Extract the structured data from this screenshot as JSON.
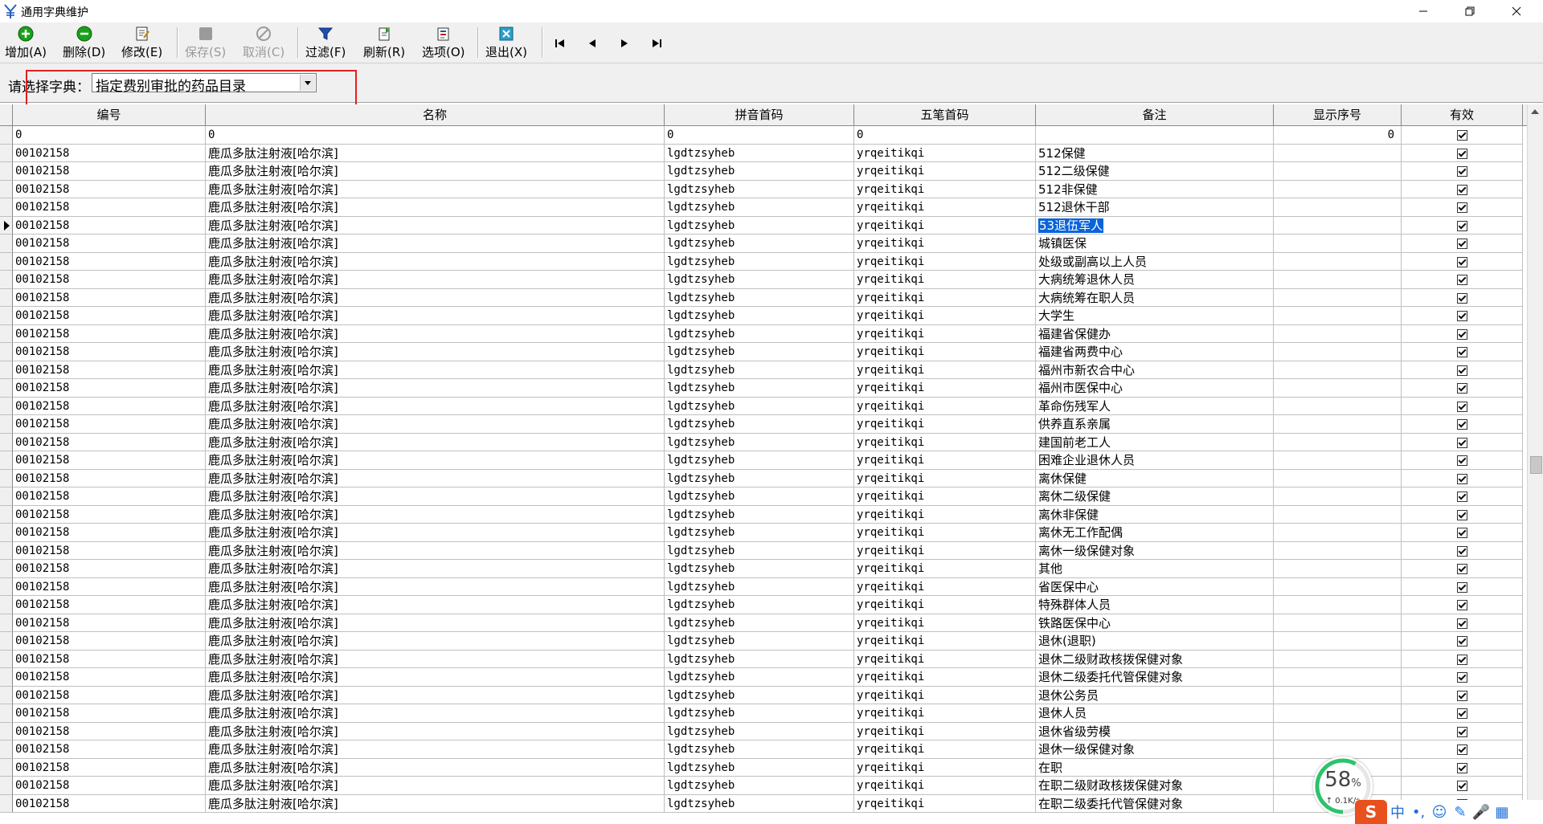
{
  "window": {
    "title": "通用字典维护",
    "minimize": "—",
    "maximize": "❐",
    "close": "✕"
  },
  "toolbar": {
    "add": "增加(A)",
    "delete": "删除(D)",
    "edit": "修改(E)",
    "save": "保存(S)",
    "cancel": "取消(C)",
    "filter": "过滤(F)",
    "refresh": "刷新(R)",
    "options": "选项(O)",
    "exit": "退出(X)",
    "first": "⏮",
    "prev": "◀",
    "next": "▶",
    "last": "⏭"
  },
  "selector": {
    "label": "请选择字典：",
    "value": "指定费别审批的药品目录"
  },
  "grid": {
    "columns": [
      "编号",
      "名称",
      "拼音首码",
      "五笔首码",
      "备注",
      "显示序号",
      "有效"
    ],
    "first_row": {
      "code": "0",
      "name": "0",
      "pinyin": "0",
      "wubi": "0",
      "note": "",
      "order": "0"
    },
    "row_code": "00102158",
    "row_name": "鹿瓜多肽注射液[哈尔滨]",
    "row_pinyin": "lgdtzsyheb",
    "row_wubi": "yrqeitikqi",
    "notes": [
      "512保健",
      "512二级保健",
      "512非保健",
      "512退休干部",
      "53退伍军人",
      "城镇医保",
      "处级或副高以上人员",
      "大病统筹退休人员",
      "大病统筹在职人员",
      "大学生",
      "福建省保健办",
      "福建省两费中心",
      "福州市新农合中心",
      "福州市医保中心",
      "革命伤残军人",
      "供养直系亲属",
      "建国前老工人",
      "困难企业退休人员",
      "离休保健",
      "离休二级保健",
      "离休非保健",
      "离休无工作配偶",
      "离休一级保健对象",
      "其他",
      "省医保中心",
      "特殊群体人员",
      "铁路医保中心",
      "退休(退职)",
      "退休二级财政核拨保健对象",
      "退休二级委托代管保健对象",
      "退休公务员",
      "退休人员",
      "退休省级劳模",
      "退休一级保健对象",
      "在职",
      "在职二级财政核拨保健对象",
      "在职二级委托代管保健对象"
    ],
    "current_row_index": 4
  },
  "overlay": {
    "speed_percent": "58",
    "speed_unit": "%",
    "speed_rate": "↑ 0.1K/s",
    "ime_lang": "中",
    "ime_punct": "•,",
    "ime_emoji": "☺",
    "ime_pen": "✎",
    "ime_mic": "🎤",
    "ime_grid": "▦"
  }
}
